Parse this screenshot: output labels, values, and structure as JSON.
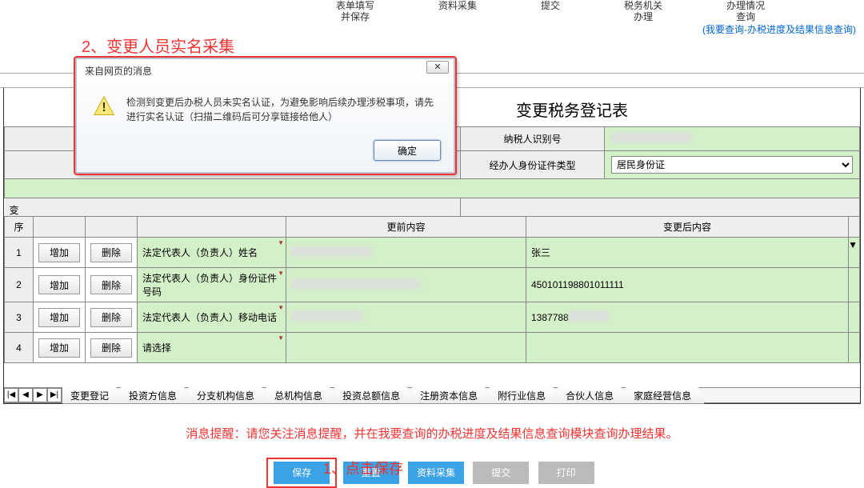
{
  "topnav": {
    "item1": "表单填写\n并保存",
    "item2": "资料采集",
    "item3": "提交",
    "item4": "税务机关\n办理",
    "item5": "办理情况\n查询"
  },
  "top_link": "(我要查询-办税进度及结果信息查询)",
  "annotation2": "2、变更人员实名采集",
  "scroll_up": "︽",
  "form_title": "变更税务登记表",
  "header": {
    "taxpayer_id_label": "纳税人识别号",
    "handler_idtype_label": "经办人身份证件类型",
    "handler_idtype_value": "居民身份证"
  },
  "col_headers": {
    "before": "更前内容",
    "after": "变更后内容"
  },
  "side_labels": {
    "change": "变",
    "seq": "序"
  },
  "rows": [
    {
      "idx": "1",
      "add": "增加",
      "del": "删除",
      "item": "法定代表人（负责人）姓名",
      "after": "张三"
    },
    {
      "idx": "2",
      "add": "增加",
      "del": "删除",
      "item": "法定代表人（负责人）身份证件号码",
      "after": "450101198801011111"
    },
    {
      "idx": "3",
      "add": "增加",
      "del": "删除",
      "item": "法定代表人（负责人）移动电话",
      "after": "1387788"
    },
    {
      "idx": "4",
      "add": "增加",
      "del": "删除",
      "item": "请选择",
      "after": ""
    }
  ],
  "navbtns": {
    "first": "|◀",
    "prev": "◀",
    "next": "▶",
    "last": "▶|"
  },
  "tabs": [
    "变更登记",
    "投资方信息",
    "分支机构信息",
    "总机构信息",
    "投资总额信息",
    "注册资本信息",
    "附行业信息",
    "合伙人信息",
    "家庭经营信息"
  ],
  "msg_hint": "消息提醒：请您关注消息提醒，并在我要查询的办税进度及结果信息查询模块查询办理结果。",
  "annotation1": "1、点击保存",
  "buttons": {
    "save": "保存",
    "reset": "重置",
    "collect": "资料采集",
    "submit": "提交",
    "print": "打印"
  },
  "dialog": {
    "title": "来自网页的消息",
    "text": "检测到变更后办税人员未实名认证，为避免影响后续办理涉税事项，请先进行实名认证（扫描二维码后可分享链接给他人）",
    "ok": "确定",
    "close": "✕"
  }
}
